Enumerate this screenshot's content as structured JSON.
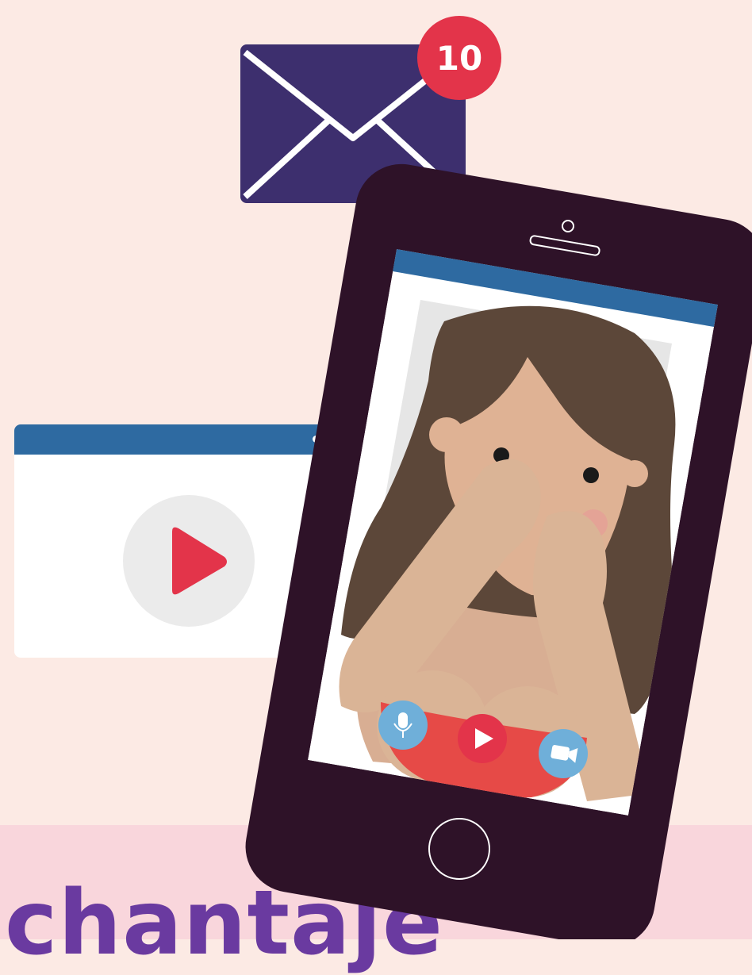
{
  "notification": {
    "count": "10"
  },
  "caption": {
    "text": "chantaje"
  },
  "icons": {
    "envelope": "mail-envelope-icon",
    "video_play": "play-icon",
    "mic": "microphone-icon",
    "play": "play-icon",
    "camera": "video-camera-icon"
  },
  "colors": {
    "background": "#fceae4",
    "band": "#f9d6dc",
    "caption": "#6a3aa0",
    "envelope": "#3d2f6e",
    "badge": "#e3344a",
    "phone_body": "#2e1228",
    "screen_bar": "#2e6aa1",
    "call_red": "#e64a47",
    "call_blue": "#6fafd9"
  }
}
